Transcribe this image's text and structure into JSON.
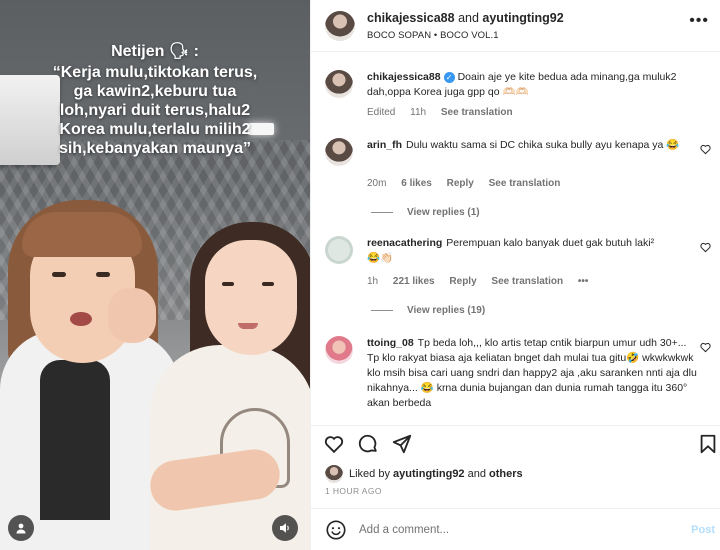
{
  "video": {
    "overlay_title": "Netijen 🗣 :",
    "overlay_quote": "“Kerja mulu,tiktokan terus,\nga kawin2,keburu tua\nloh,nyari duit terus,halu2\nKorea mulu,terlalu milih2\nsih,kebanyakan maunya”"
  },
  "post": {
    "author1": "chikajessica88",
    "and_text": "and",
    "author2": "ayutingting92",
    "audio": "BOCO SOPAN • BOCO VOL.1",
    "more": "•••"
  },
  "comments": [
    {
      "username": "chikajessica88",
      "verified": true,
      "text": "Doain aje ye kite bedua ada minang,ga muluk2 dah,oppa Korea juga gpp qo 🫶🏻🫶🏻",
      "meta": [
        "Edited",
        "11h",
        "See translation"
      ]
    },
    {
      "username": "arin_fh",
      "text": "Dulu waktu sama si DC chika suka bully ayu kenapa ya 😂",
      "meta": [
        "20m",
        "6 likes",
        "Reply",
        "See translation"
      ],
      "view_replies": "View replies (1)"
    },
    {
      "username": "reenacathering",
      "text": "Perempuan kalo banyak duet gak butuh laki²",
      "emoji_line": "😂👏🏻",
      "meta": [
        "1h",
        "221 likes",
        "Reply",
        "See translation",
        "•••"
      ],
      "view_replies": "View replies (19)"
    },
    {
      "username": "ttoing_08",
      "text": "Tp beda loh,,, klo artis tetap cntik biarpun umur udh 30+... Tp klo rakyat biasa aja keliatan bnget dah mulai tua gitu🤣 wkwkwkwk klo msih bisa cari uang sndri dan happy2 aja ,aku saranken nnti aja dlu nikahnya... 😂 krna dunia bujangan dan dunia rumah tangga itu 360° akan berbeda"
    }
  ],
  "likes": {
    "prefix": "Liked by",
    "user": "ayutingting92",
    "suffix": "and",
    "others": "others"
  },
  "time_ago": "1 HOUR AGO",
  "add_comment": {
    "placeholder": "Add a comment...",
    "post_label": "Post"
  },
  "colors": {
    "verified": "#3897f0",
    "post_button": "#b2dffc",
    "meta_text": "#737373"
  }
}
